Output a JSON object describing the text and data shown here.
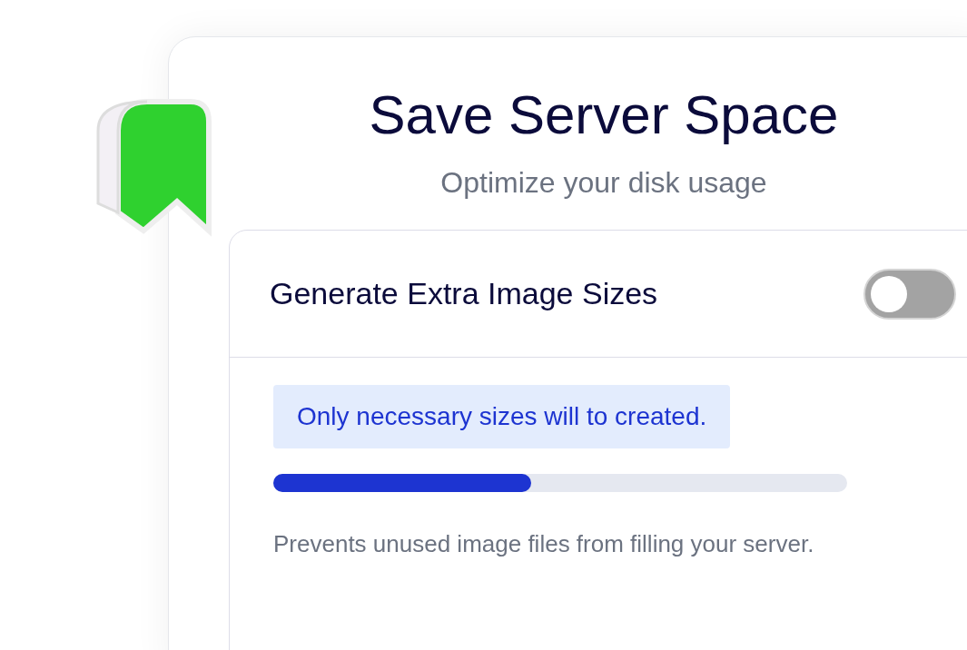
{
  "panel": {
    "title": "Save Server Space",
    "subtitle": "Optimize your disk usage"
  },
  "setting": {
    "label": "Generate Extra Image Sizes",
    "on": false,
    "notice": "Only necessary sizes will to created.",
    "progress": {
      "level": 0.45
    },
    "description": "Prevents unused image files from filling your server."
  }
}
